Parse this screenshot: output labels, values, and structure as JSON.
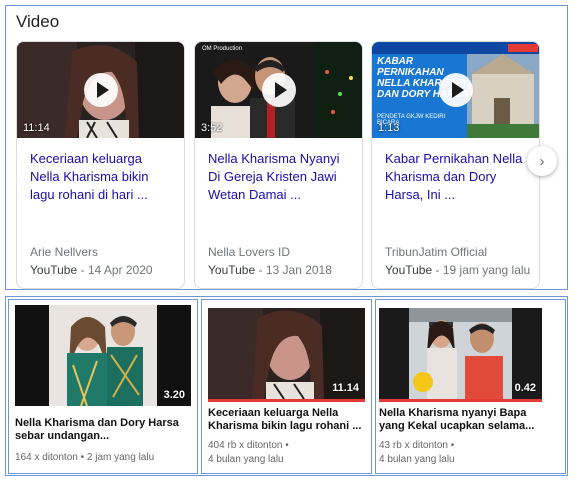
{
  "section": {
    "title": "Video"
  },
  "video_cards": [
    {
      "duration": "11:14",
      "title": "Keceriaan keluarga Nella Kharisma bikin lagu rohani di hari ...",
      "channel": "Arie Nellvers",
      "source": "YouTube",
      "date": "14 Apr 2020"
    },
    {
      "duration": "3:52",
      "thumb_caption": "OM Production",
      "title": "Nella Kharisma Nyanyi Di Gereja Kristen Jawi Wetan Damai ...",
      "channel": "Nella Lovers ID",
      "source": "YouTube",
      "date": "13 Jan 2018"
    },
    {
      "duration": "1:13",
      "thumb_headline": "KABAR PERNIKAHAN NELLA KHARISMA DAN DORY HARSA",
      "thumb_sub": "PENDETA GKJW KEDIRI BICARA",
      "title": "Kabar Pernikahan Nella Kharisma dan Dory Harsa, Ini ...",
      "channel": "TribunJatim Official",
      "source": "YouTube",
      "date": "19 jam yang lalu"
    }
  ],
  "next_button": {
    "icon": "chevron-right-icon",
    "glyph": "›"
  },
  "bottom_cards": [
    {
      "duration": "3.20",
      "title": "Nella Kharisma dan Dory Harsa sebar undangan...",
      "meta_line1": "164 x ditonton • 2 jam yang lalu",
      "meta_line2": ""
    },
    {
      "duration": "11.14",
      "title": "Keceriaan keluarga Nella Kharisma bikin lagu rohani ...",
      "meta_line1": "404 rb x ditonton •",
      "meta_line2": "4 bulan yang lalu"
    },
    {
      "duration": "0.42",
      "title": "Nella Kharisma nyanyi Bapa yang Kekal ucapkan selama...",
      "meta_line1": "43 rb x ditonton •",
      "meta_line2": "4 bulan yang lalu"
    }
  ],
  "colors": {
    "link": "#1a0dab",
    "panel_border": "#6f97d6",
    "progress_red": "#e53935"
  }
}
